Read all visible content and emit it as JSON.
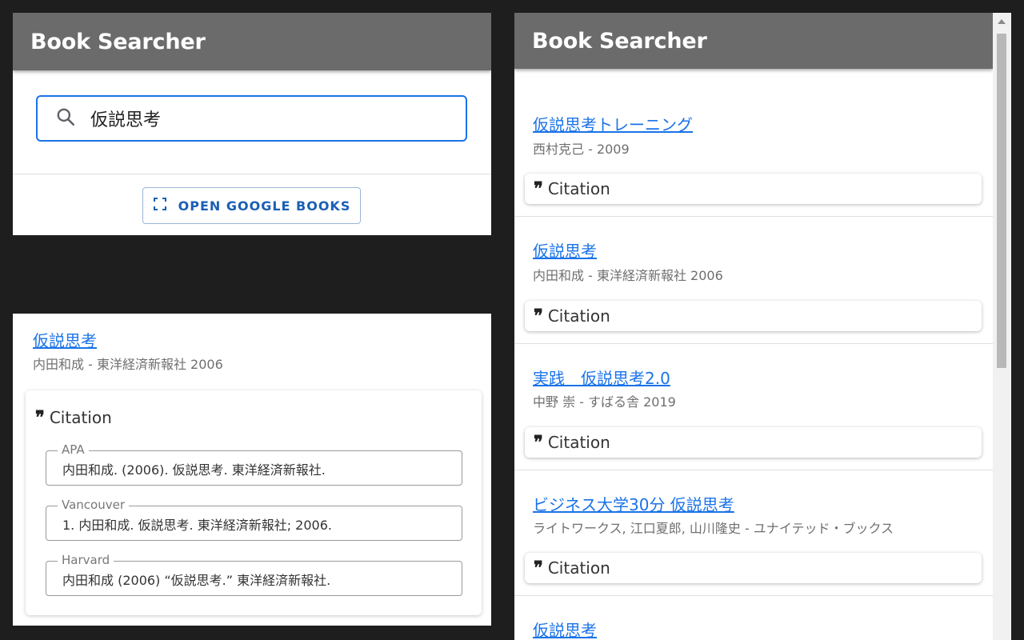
{
  "panel_search": {
    "app_title": "Book Searcher",
    "search_value": "仮説思考",
    "search_icon": "search-icon",
    "open_button_label": "OPEN GOOGLE BOOKS",
    "open_button_icon": "fullscreen-icon"
  },
  "panel_citation": {
    "book_title": "仮説思考",
    "book_meta": "内田和成 - 東洋経済新報社 2006",
    "citation_label": "Citation",
    "citations": [
      {
        "style": "APA",
        "text": "内田和成. (2006). 仮説思考. 東洋経済新報社."
      },
      {
        "style": "Vancouver",
        "text": "1.  内田和成. 仮説思考. 東洋経済新報社; 2006."
      },
      {
        "style": "Harvard",
        "text": "内田和成 (2006) “仮説思考.” 東洋経済新報社."
      }
    ]
  },
  "panel_results": {
    "app_title": "Book Searcher",
    "citation_label": "Citation",
    "results": [
      {
        "title": "仮説思考トレーニング",
        "meta": "西村克己 - 2009"
      },
      {
        "title": "仮説思考",
        "meta": "内田和成 - 東洋経済新報社 2006"
      },
      {
        "title": "実践　仮説思考2.0",
        "meta": "中野 崇 - すばる舎 2019"
      },
      {
        "title": "ビジネス大学30分 仮説思考",
        "meta": "ライトワークス, 江口夏郎, 山川隆史 - ユナイテッド・ブックス"
      },
      {
        "title": "仮説思考",
        "meta": ""
      }
    ]
  },
  "colors": {
    "app_bar": "#6b6b6b",
    "accent": "#1a73e8",
    "background": "#1e1e1e"
  }
}
